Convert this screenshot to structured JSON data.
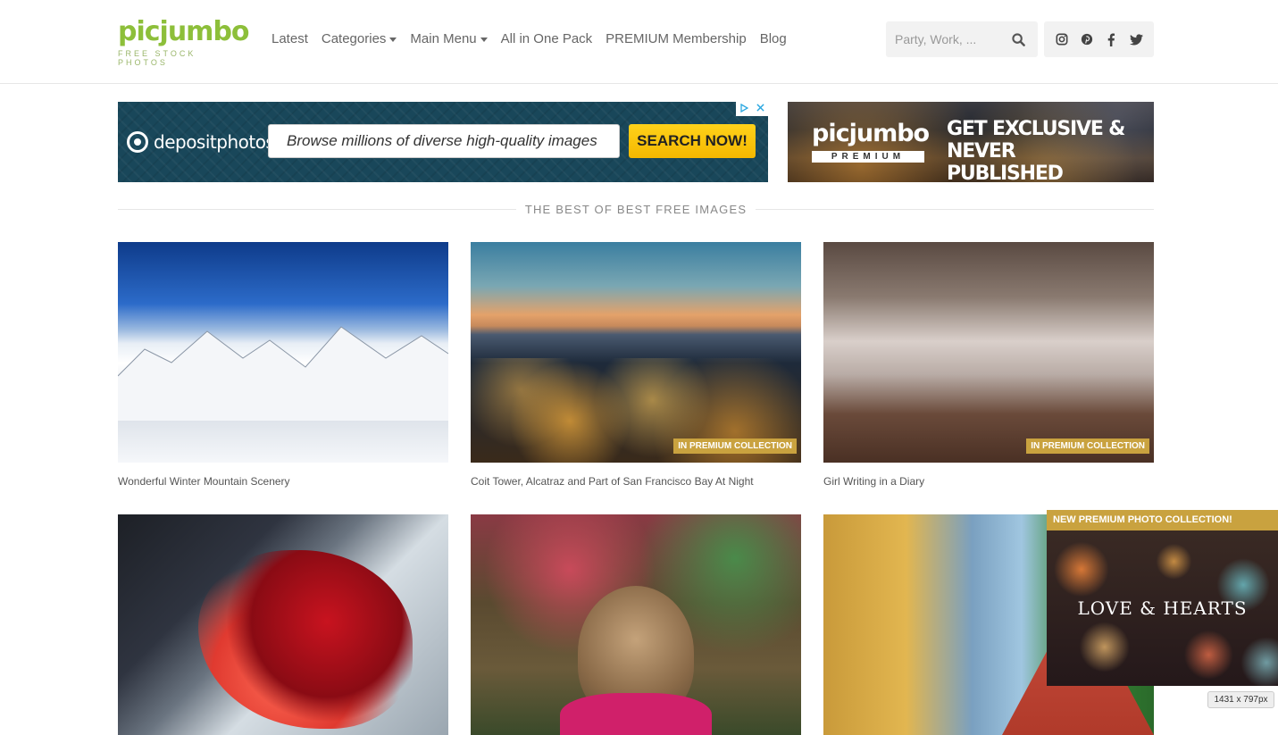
{
  "header": {
    "logo": {
      "wordmark": "picjumbo",
      "tagline": "FREE STOCK PHOTOS"
    },
    "nav": [
      {
        "label": "Latest",
        "has_dropdown": false
      },
      {
        "label": "Categories",
        "has_dropdown": true
      },
      {
        "label": "Main Menu",
        "has_dropdown": true
      },
      {
        "label": "All in One Pack",
        "has_dropdown": false
      },
      {
        "label": "PREMIUM Membership",
        "has_dropdown": false
      },
      {
        "label": "Blog",
        "has_dropdown": false
      }
    ],
    "search": {
      "placeholder": "Party, Work, ...",
      "icon": "search-icon"
    },
    "social": [
      {
        "name": "instagram-icon"
      },
      {
        "name": "pinterest-icon"
      },
      {
        "name": "facebook-icon"
      },
      {
        "name": "twitter-icon"
      }
    ]
  },
  "ads": {
    "depositphotos": {
      "brand": "depositphotos",
      "search_text": "Browse millions of diverse high-quality images",
      "button": "SEARCH NOW!"
    },
    "premium": {
      "brand": "picjumbo",
      "badge": "PREMIUM",
      "headline_line1": "GET EXCLUSIVE & NEVER",
      "headline_line2": "PUBLISHED PHOTOS!"
    }
  },
  "section": {
    "title": "THE BEST OF BEST FREE IMAGES"
  },
  "photos": [
    {
      "caption": "Wonderful Winter Mountain Scenery",
      "premium": false,
      "tag": ""
    },
    {
      "caption": "Coit Tower, Alcatraz and Part of San Francisco Bay At Night",
      "premium": true,
      "tag": "IN PREMIUM COLLECTION"
    },
    {
      "caption": "Girl Writing in a Diary",
      "premium": true,
      "tag": "IN PREMIUM COLLECTION"
    },
    {
      "caption": "",
      "premium": false,
      "tag": ""
    },
    {
      "caption": "",
      "premium": false,
      "tag": ""
    },
    {
      "caption": "",
      "premium": false,
      "tag": ""
    }
  ],
  "popup": {
    "title": "NEW PREMIUM PHOTO COLLECTION!",
    "image_text": "LOVE & HEARTS"
  },
  "dimensions_badge": "1431 x 797px",
  "colors": {
    "brand_green": "#8dbf3a",
    "premium_gold": "#c9a23f",
    "ad_button_yellow": "#ffd21a",
    "ad_background": "#19475a"
  }
}
